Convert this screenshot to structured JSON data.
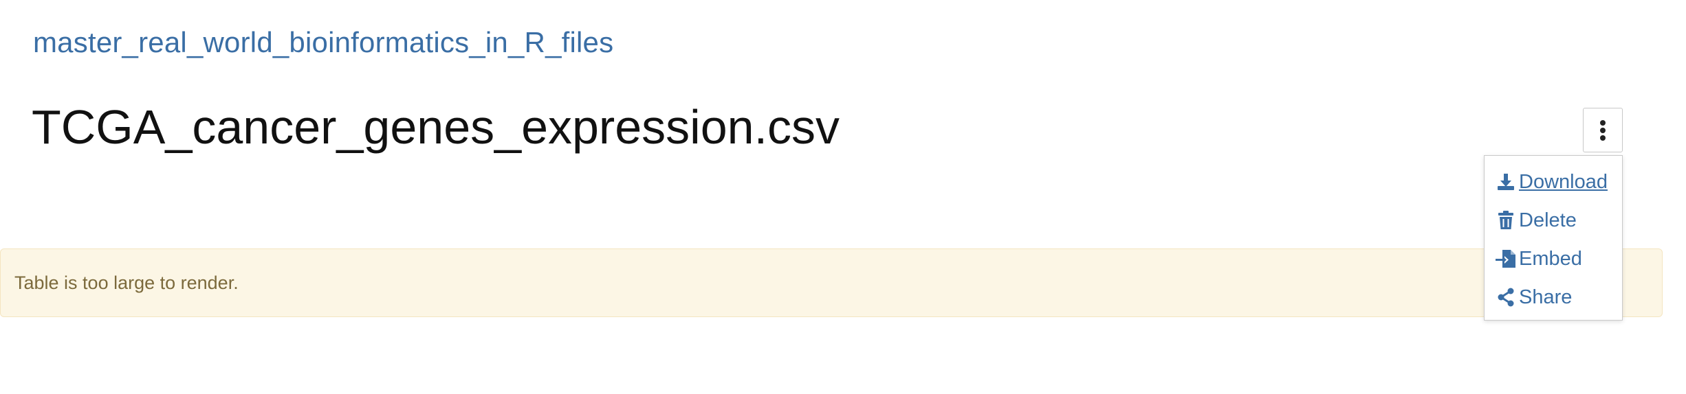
{
  "breadcrumb": {
    "label": "master_real_world_bioinformatics_in_R_files"
  },
  "file": {
    "title": "TCGA_cancer_genes_expression.csv"
  },
  "notice": {
    "text": "Table is too large to render."
  },
  "actions_menu": {
    "items": [
      {
        "label": "Download",
        "icon": "download-icon"
      },
      {
        "label": "Delete",
        "icon": "trash-icon"
      },
      {
        "label": "Embed",
        "icon": "embed-icon"
      },
      {
        "label": "Share",
        "icon": "share-icon"
      }
    ]
  },
  "colors": {
    "link": "#3a6ea5",
    "title": "#111111",
    "notice_background": "#fcf6e5",
    "notice_text": "#7c6a3c"
  }
}
